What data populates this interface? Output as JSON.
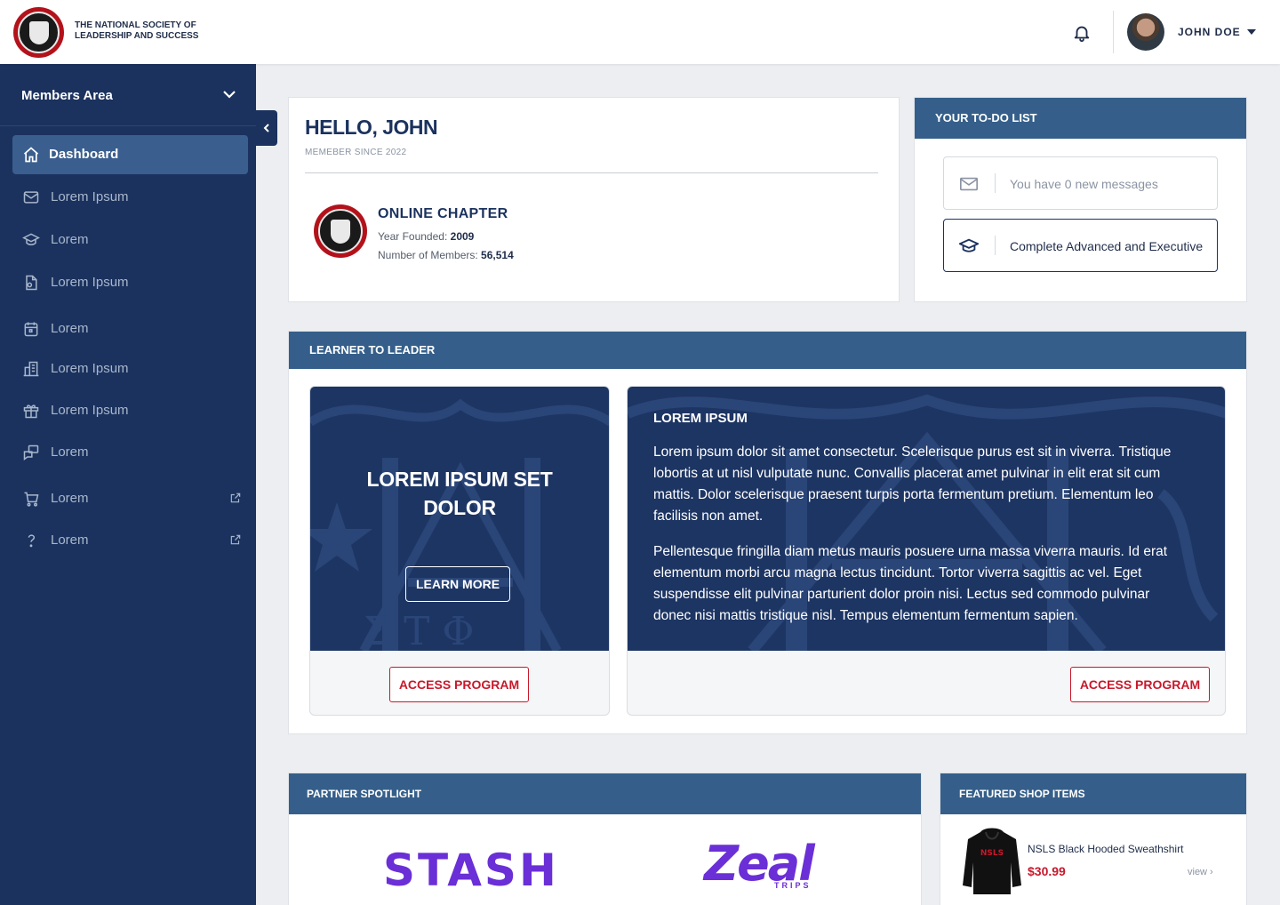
{
  "brand": {
    "name_line1": "THE NATIONAL SOCIETY OF",
    "name_line2": "LEADERSHIP AND SUCCESS",
    "accent": "#b3121b",
    "navy": "#1b325e",
    "panel_blue": "#355f8a"
  },
  "header": {
    "user_name": "JOHN DOE"
  },
  "sidebar": {
    "title": "Members Area",
    "items": [
      {
        "label": "Dashboard",
        "icon": "home-icon",
        "active": true
      },
      {
        "label": "Lorem Ipsum",
        "icon": "mail-icon"
      },
      {
        "label": "Lorem",
        "icon": "graduation-cap-icon"
      },
      {
        "label": "Lorem Ipsum",
        "icon": "document-icon"
      },
      {
        "label": "Lorem",
        "icon": "calendar-icon"
      },
      {
        "label": "Lorem Ipsum",
        "icon": "building-icon"
      },
      {
        "label": "Lorem Ipsum",
        "icon": "gift-icon"
      },
      {
        "label": "Lorem",
        "icon": "chat-icon"
      },
      {
        "label": "Lorem",
        "icon": "cart-icon",
        "external": true
      },
      {
        "label": "Lorem",
        "icon": "help-icon",
        "external": true
      }
    ]
  },
  "welcome": {
    "greeting": "HELLO, JOHN",
    "member_since": "MEMEBER SINCE 2022",
    "chapter_name": "ONLINE CHAPTER",
    "year_label": "Year Founded:",
    "year_value": "2009",
    "members_label": "Number of Members:",
    "members_value": "56,514"
  },
  "todo": {
    "title": "YOUR TO-DO LIST",
    "items": [
      {
        "text": "You have 0 new messages",
        "icon": "envelope-icon"
      },
      {
        "text": "Complete Advanced and Executive",
        "icon": "graduation-cap-icon"
      }
    ]
  },
  "learner": {
    "title": "LEARNER TO LEADER",
    "promo_title_line1": "LOREM IPSUM SET",
    "promo_title_line2": "DOLOR",
    "learn_more": "LEARN MORE",
    "access_program": "ACCESS PROGRAM",
    "detail_heading": "LOREM IPSUM",
    "detail_p1": "Lorem ipsum dolor sit amet consectetur. Scelerisque purus est sit in viverra. Tristique lobortis at ut nisl vulputate nunc. Convallis placerat amet pulvinar in elit erat sit cum mattis. Dolor scelerisque praesent turpis porta fermentum pretium. Elementum leo facilisis non amet.",
    "detail_p2": "Pellentesque fringilla diam metus mauris posuere urna massa viverra mauris. Id erat elementum morbi arcu magna lectus tincidunt. Tortor viverra sagittis ac vel. Eget suspendisse elit pulvinar parturient dolor proin nisi. Lectus sed commodo pulvinar donec nisi mattis tristique nisl. Tempus elementum fermentum sapien."
  },
  "partners": {
    "title": "PARTNER SPOTLIGHT",
    "logos": [
      {
        "text": "STASH"
      },
      {
        "text": "Zeal",
        "sub": "TRIPS"
      }
    ]
  },
  "shop": {
    "title": "FEATURED SHOP ITEMS",
    "item_name": "NSLS Black Hooded Sweathshirt",
    "item_price": "$30.99",
    "view_label": "view ›",
    "item_print": "NSLS"
  }
}
